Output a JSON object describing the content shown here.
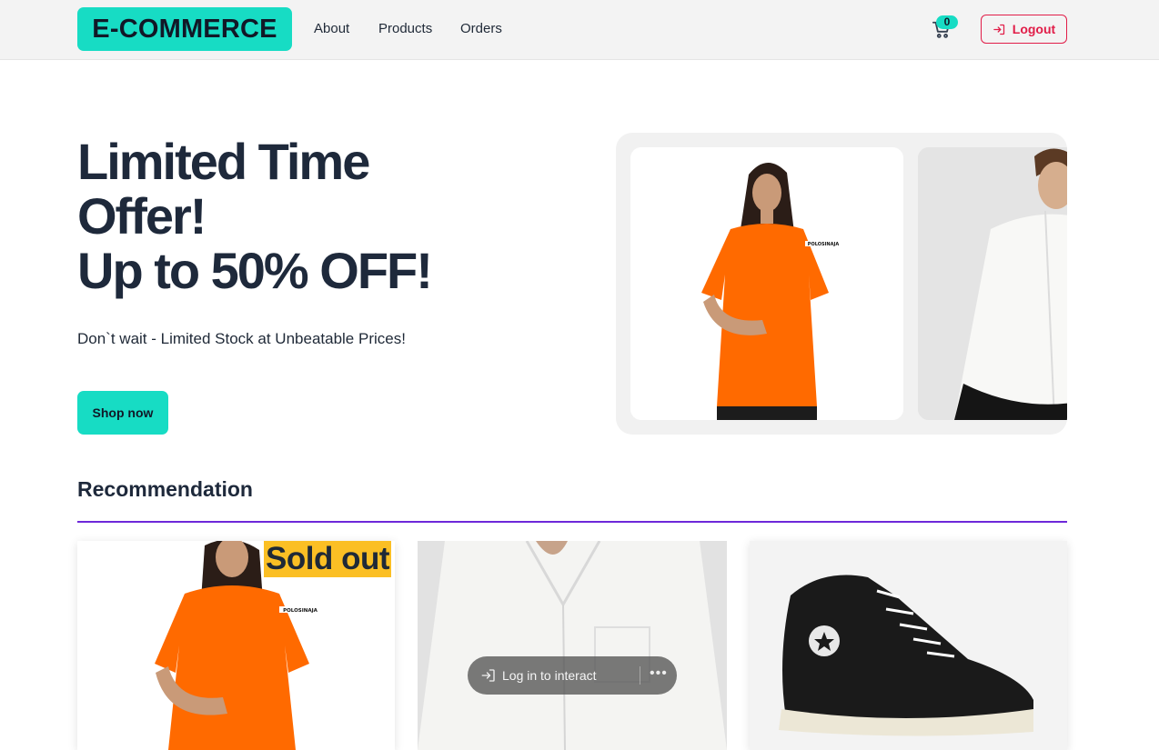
{
  "nav": {
    "logo": "E-COMMERCE",
    "links": [
      "About",
      "Products",
      "Orders"
    ],
    "cart_count": "0",
    "logout_label": "Logout"
  },
  "hero": {
    "title_line1": "Limited Time",
    "title_line2": "Offer!",
    "title_line3": "Up to 50% OFF!",
    "subtitle": "Don`t wait - Limited Stock at Unbeatable Prices!",
    "cta_label": "Shop now",
    "slide1_brand": "POLOSINAJA"
  },
  "recommendation": {
    "heading": "Recommendation",
    "badge": "Sold out",
    "card1_brand": "POLOSINAJA"
  },
  "overlay": {
    "login_label": "Log in to interact",
    "more_label": "•••"
  },
  "colors": {
    "accent": "#17dcc4",
    "danger": "#e11d48",
    "divider": "#6d28d9",
    "badge": "#fbbf24"
  }
}
